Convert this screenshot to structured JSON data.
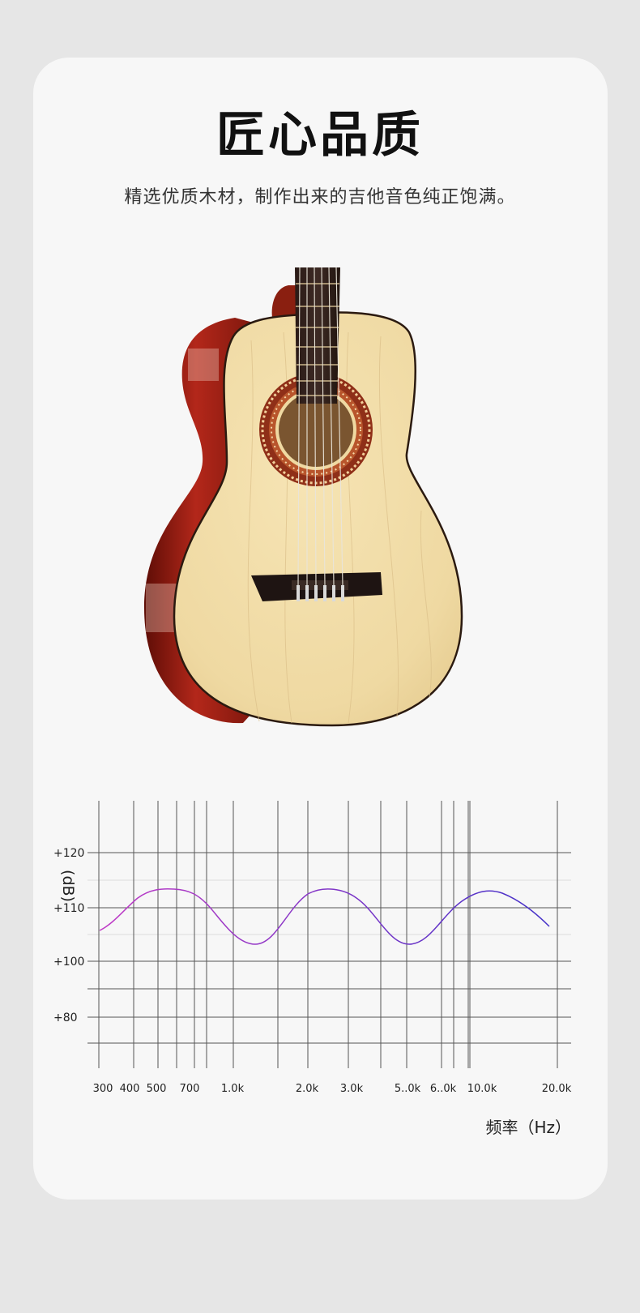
{
  "header": {
    "title": "匠心品质",
    "subtitle": "精选优质木材，制作出来的吉他音色纯正饱满。"
  },
  "chart_data": {
    "type": "line",
    "ylabel": "(dB)",
    "xlabel": "频率（Hz）",
    "y_ticks": [
      "+120",
      "+110",
      "+100",
      "+80"
    ],
    "x_ticks": [
      "300",
      "400",
      "500",
      "700",
      "1.0k",
      "2.0k",
      "3.0k",
      "5..0k",
      "6..0k",
      "10.0k",
      "20.0k"
    ],
    "x_scale": "log",
    "grid": true,
    "colors": {
      "start": "#c03bc6",
      "end": "#4431c8"
    }
  }
}
